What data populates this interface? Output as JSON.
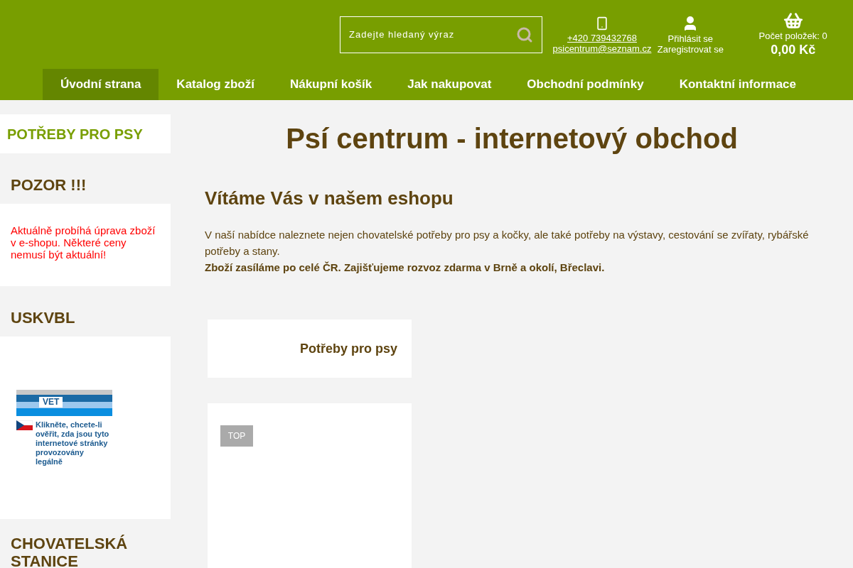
{
  "header": {
    "search": {
      "placeholder": "Zadejte hledaný výraz"
    },
    "phone": "+420 739432768",
    "email": "psicentrum@seznam.cz",
    "login": "Přihlásit se",
    "register": "Zaregistrovat se",
    "cart_count": "Počet položek: 0",
    "cart_total": "0,00 Kč"
  },
  "nav": [
    {
      "label": "Úvodní strana",
      "selected": true
    },
    {
      "label": "Katalog zboží",
      "selected": false
    },
    {
      "label": "Nákupní košík",
      "selected": false
    },
    {
      "label": "Jak nakupovat",
      "selected": false
    },
    {
      "label": "Obchodní podmínky",
      "selected": false
    },
    {
      "label": "Kontaktní informace",
      "selected": false
    }
  ],
  "sidebar": {
    "category": "POTŘEBY PRO PSY",
    "notice_title": "POZOR !!!",
    "notice_text": "Aktuálně probíhá úprava zboží v e-shopu. Některé ceny nemusí být aktuální!",
    "badge_title": "USKVBL",
    "badge": {
      "label": "VET",
      "text": "Klikněte, chcete-li ověřit, zda jsou tyto internetové stránky provozovány legálně"
    },
    "station_title": "CHOVATELSKÁ STANICE"
  },
  "main": {
    "title": "Psí centrum - internetový obchod",
    "heading": "Vítáme Vás v našem eshopu",
    "paragraph": "V naší nabídce naleznete nejen chovatelské potřeby pro psy a kočky, ale také potřeby na výstavy, cestování se zvířaty, rybářské potřeby a stany.",
    "bold_line": "Zboží zasíláme po celé ČR. Zajišťujeme rozvoz zdarma v Brně a okolí, Břeclavi.",
    "category_card": "Potřeby pro psy",
    "top_button": "TOP"
  }
}
